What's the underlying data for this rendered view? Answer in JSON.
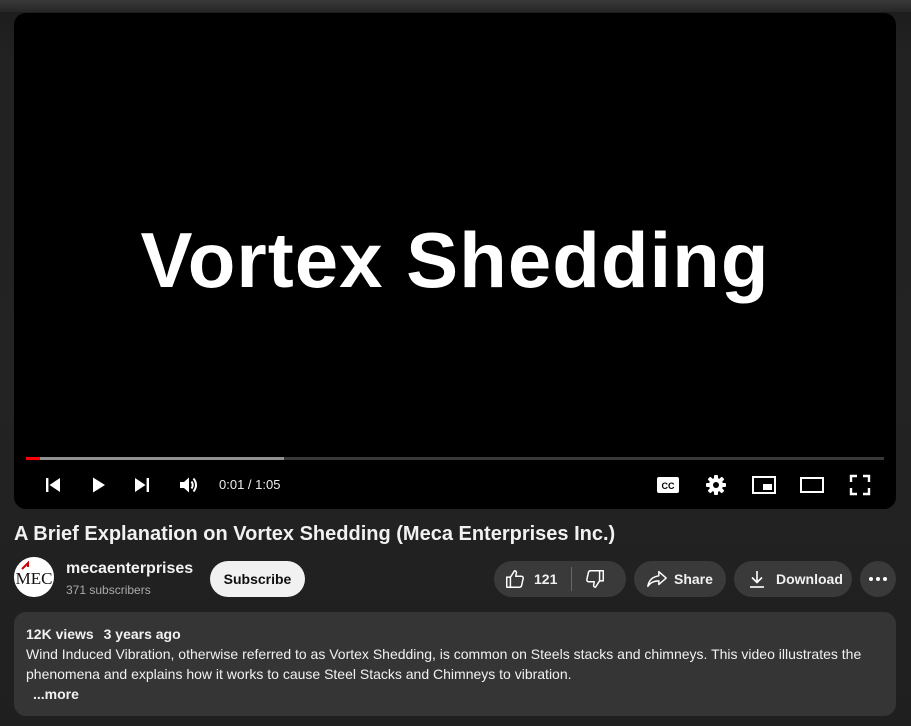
{
  "player": {
    "title_card": "Vortex Shedding",
    "current_time": "0:01",
    "duration": "1:05",
    "time_display": "0:01 / 1:05",
    "progress_played_fraction": 0.016,
    "progress_buffered_fraction": 0.301,
    "controls": [
      "previous-icon",
      "play-icon",
      "next-icon",
      "volume-icon",
      "captions-icon",
      "settings-icon",
      "miniplayer-icon",
      "theater-icon",
      "fullscreen-icon"
    ]
  },
  "video": {
    "title": "A Brief Explanation on Vortex Shedding (Meca Enterprises Inc.)"
  },
  "channel": {
    "avatar_text": "MEC",
    "name": "mecaenterprises",
    "subscribers": "371 subscribers",
    "subscribe_label": "Subscribe"
  },
  "actions": {
    "like_count": "121",
    "share_label": "Share",
    "download_label": "Download"
  },
  "description": {
    "views": "12K views",
    "age": "3 years ago",
    "text": "Wind Induced Vibration, otherwise referred to as Vortex Shedding, is common on Steels stacks and chimneys.  This video illustrates the phenomena and explains how it works to cause Steel Stacks and Chimneys to vibration.",
    "more_label": "...more"
  },
  "colors": {
    "progress_played": "#ff0000",
    "background": "#222222",
    "pill": "#3a3a3a",
    "description_bg": "#353535",
    "subscribe_bg": "#f1f1f1"
  }
}
